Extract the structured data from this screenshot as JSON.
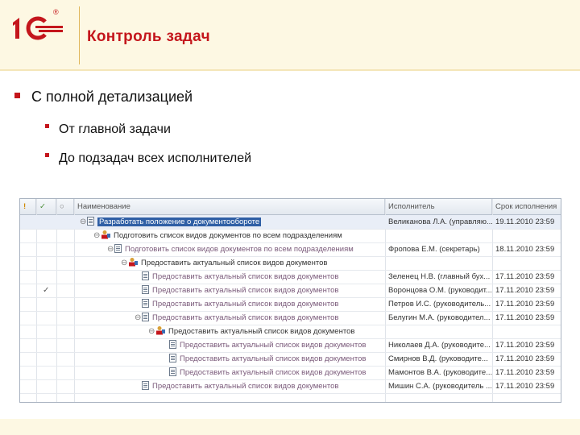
{
  "header": {
    "title": "Контроль задач"
  },
  "bullets": {
    "level1": "С полной детализацией",
    "level2": [
      "От главной задачи",
      "До подзадач всех исполнителей"
    ]
  },
  "grid": {
    "columns": {
      "name": "Наименование",
      "executor": "Исполнитель",
      "deadline": "Срок исполнения"
    },
    "rows": [
      {
        "name": "Разработать положение о документообороте",
        "executor": "Великанова Л.А. (управляю...",
        "deadline": "19.11.2010 23:59",
        "level": 0,
        "icon": "doc-icon",
        "expander": "⊖",
        "selected": true,
        "done": false
      },
      {
        "name": "Подготовить список видов документов по всем подразделениям",
        "executor": "",
        "deadline": "",
        "level": 1,
        "icon": "group-icon",
        "expander": "⊖",
        "selected": false,
        "done": false
      },
      {
        "name": "Подготовить список видов документов по всем подразделениям",
        "executor": "Фропова Е.М. (секретарь)",
        "deadline": "18.11.2010 23:59",
        "level": 2,
        "icon": "doc-icon",
        "expander": "⊖",
        "selected": false,
        "done": false
      },
      {
        "name": "Предоставить актуальный список видов документов",
        "executor": "",
        "deadline": "",
        "level": 3,
        "icon": "group-icon",
        "expander": "⊖",
        "selected": false,
        "done": false
      },
      {
        "name": "Предоставить актуальный список видов документов",
        "executor": "Зеленец Н.В. (главный бух...",
        "deadline": "17.11.2010 23:59",
        "level": 4,
        "icon": "doc-icon",
        "expander": "",
        "selected": false,
        "done": false
      },
      {
        "name": "Предоставить актуальный список видов документов",
        "executor": "Воронцова О.М. (руководит...",
        "deadline": "17.11.2010 23:59",
        "level": 4,
        "icon": "doc-icon",
        "expander": "",
        "selected": false,
        "done": true
      },
      {
        "name": "Предоставить актуальный список видов документов",
        "executor": "Петров И.С. (руководитель...",
        "deadline": "17.11.2010 23:59",
        "level": 4,
        "icon": "doc-icon",
        "expander": "",
        "selected": false,
        "done": false
      },
      {
        "name": "Предоставить актуальный список видов документов",
        "executor": "Белугин М.А. (руководител...",
        "deadline": "17.11.2010 23:59",
        "level": 4,
        "icon": "doc-icon",
        "expander": "⊖",
        "selected": false,
        "done": false
      },
      {
        "name": "Предоставить актуальный список видов документов",
        "executor": "",
        "deadline": "",
        "level": 5,
        "icon": "group-icon",
        "expander": "⊖",
        "selected": false,
        "done": false
      },
      {
        "name": "Предоставить актуальный список видов документов",
        "executor": "Николаев Д.А. (руководите...",
        "deadline": "17.11.2010 23:59",
        "level": 6,
        "icon": "doc-icon",
        "expander": "",
        "selected": false,
        "done": false
      },
      {
        "name": "Предоставить актуальный список видов документов",
        "executor": "Смирнов В.Д. (руководите...",
        "deadline": "17.11.2010 23:59",
        "level": 6,
        "icon": "doc-icon",
        "expander": "",
        "selected": false,
        "done": false
      },
      {
        "name": "Предоставить актуальный список видов документов",
        "executor": "Мамонтов В.А. (руководите...",
        "deadline": "17.11.2010 23:59",
        "level": 6,
        "icon": "doc-icon",
        "expander": "",
        "selected": false,
        "done": false
      },
      {
        "name": "Предоставить актуальный список видов документов",
        "executor": "Мишин С.А. (руководитель ...",
        "deadline": "17.11.2010 23:59",
        "level": 4,
        "icon": "doc-icon",
        "expander": "",
        "selected": false,
        "done": false
      }
    ]
  },
  "colors": {
    "accent": "#c4161c",
    "selection": "#2f5fa5",
    "header_bg": "#fdf8e3"
  }
}
